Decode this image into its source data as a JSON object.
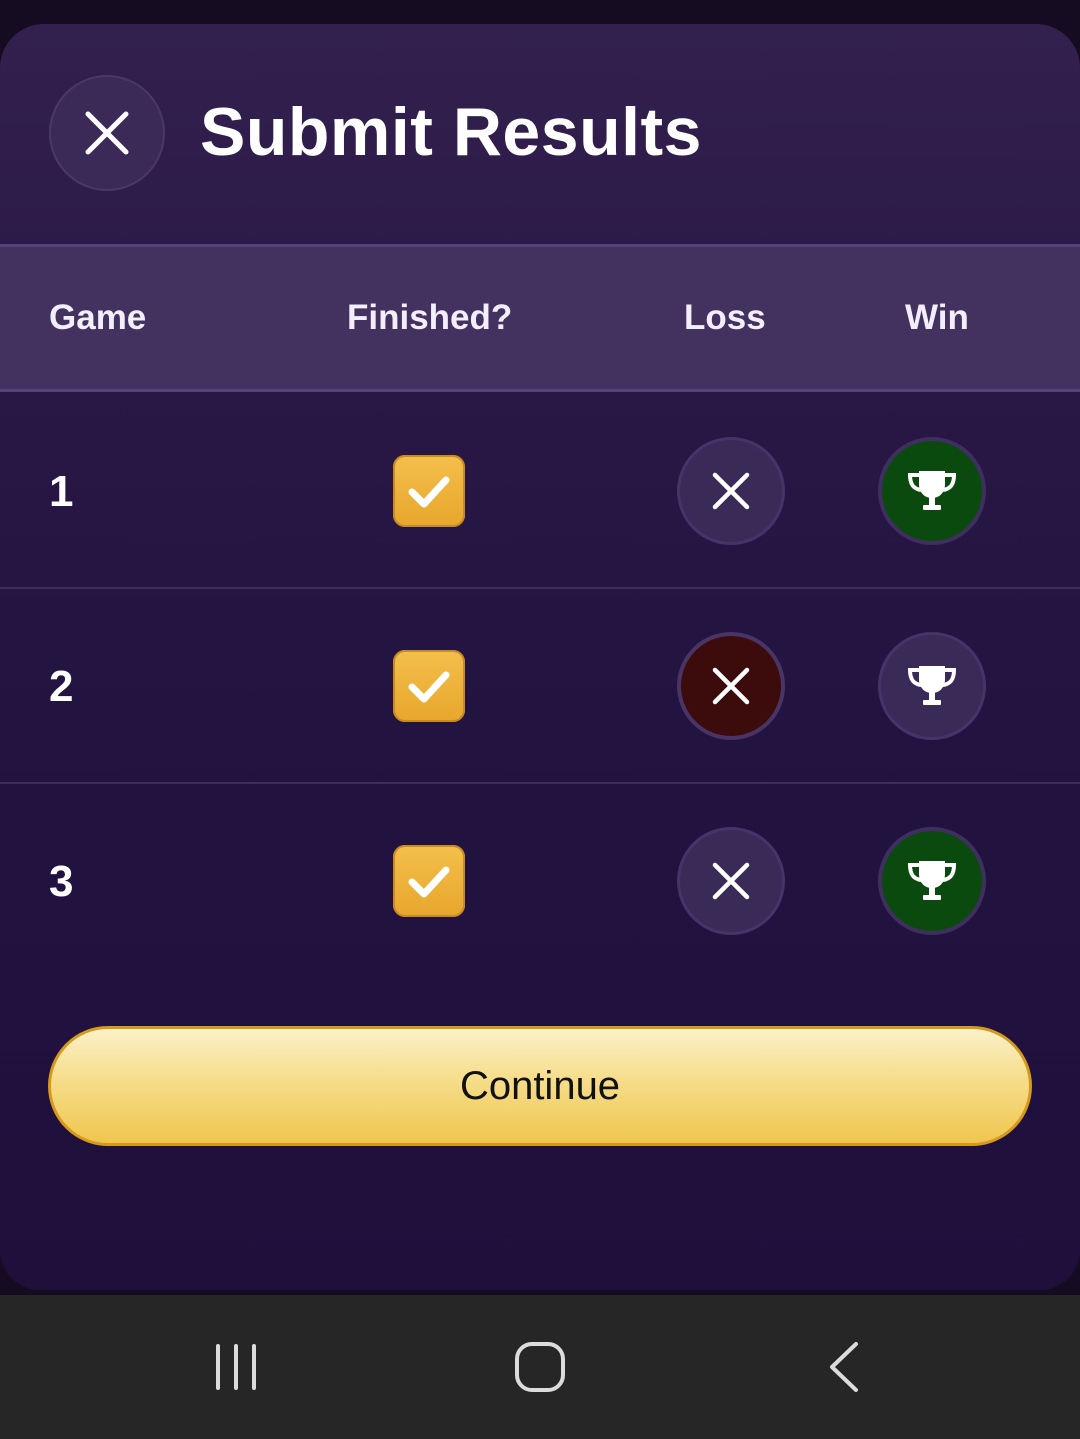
{
  "header": {
    "title": "Submit Results",
    "close_icon": "close-icon"
  },
  "table": {
    "columns": [
      "Game",
      "Finished?",
      "Loss",
      "Win"
    ],
    "rows": [
      {
        "game": "1",
        "finished": true,
        "loss_selected": false,
        "win_selected": true
      },
      {
        "game": "2",
        "finished": true,
        "loss_selected": true,
        "win_selected": false
      },
      {
        "game": "3",
        "finished": true,
        "loss_selected": false,
        "win_selected": true
      }
    ]
  },
  "actions": {
    "continue_label": "Continue"
  },
  "navbar": {
    "icons": [
      "recent-apps-icon",
      "home-icon",
      "back-icon"
    ]
  },
  "colors": {
    "accent_gold": "#efc64e",
    "checkbox": "#f3c04b",
    "win_selected": "#0a4a0e",
    "loss_selected": "#3c0b0b",
    "background": "#231341"
  }
}
